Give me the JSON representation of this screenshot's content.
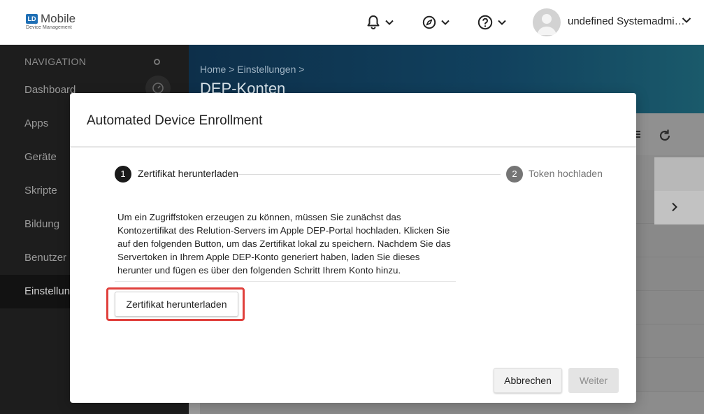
{
  "app": {
    "logo_mark": "LD",
    "logo_title": "Mobile",
    "logo_subtitle": "Device Management"
  },
  "header": {
    "icons": [
      "bell-icon",
      "compass-icon",
      "help-icon"
    ],
    "user_name": "undefined Systemadmi…"
  },
  "sidebar": {
    "heading": "NAVIGATION",
    "items": [
      {
        "label": "Dashboard"
      },
      {
        "label": "Apps"
      },
      {
        "label": "Geräte"
      },
      {
        "label": "Skripte"
      },
      {
        "label": "Bildung"
      },
      {
        "label": "Benutzer"
      },
      {
        "label": "Einstellungen",
        "active": true
      }
    ]
  },
  "content": {
    "breadcrumb": "Home > Einstellungen >",
    "page_title": "DEP-Konten"
  },
  "modal": {
    "title": "Automated Device Enrollment",
    "steps": [
      {
        "number": "1",
        "label": "Zertifikat herunterladen",
        "active": true
      },
      {
        "number": "2",
        "label": "Token hochladen",
        "active": false
      }
    ],
    "intro_text": "Um ein Zugriffstoken erzeugen zu können, müssen Sie zunächst das Kontozertifikat des Relution-Servers im Apple DEP-Portal hochladen. Klicken Sie auf den folgenden Button, um das Zertifikat lokal zu speichern. Nachdem Sie das Servertoken in Ihrem Apple DEP-Konto generiert haben, laden Sie dieses herunter und fügen es über den folgenden Schritt Ihrem Konto hinzu.",
    "download_button": "Zertifikat herunterladen",
    "cancel_button": "Abbrechen",
    "next_button": "Weiter"
  },
  "colors": {
    "highlight": "#e0403c",
    "sidebar_bg": "#1d1d1d",
    "hero_bg": "#0d2f4a",
    "logo_blue": "#1f6fb5"
  }
}
